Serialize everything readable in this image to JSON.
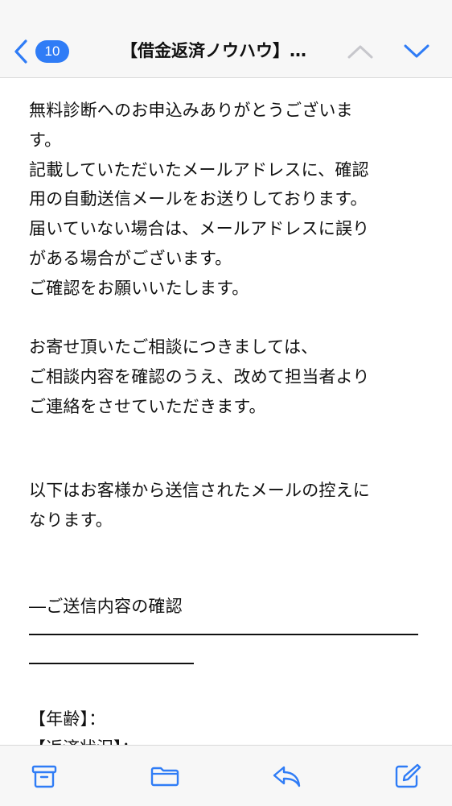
{
  "nav": {
    "badge_count": "10",
    "title": "【借金返済ノウハウ】…",
    "accent_color": "#2f7cf6",
    "icons": [
      "chevron-left-icon",
      "chevron-up-icon",
      "chevron-down-icon"
    ]
  },
  "message": {
    "paragraph1": [
      "無料診断へのお申込みありがとうございま",
      "す。",
      "記載していただいたメールアドレスに、確認",
      "用の自動送信メールをお送りしております。",
      "届いていない場合は、メールアドレスに誤り",
      "がある場合がございます。",
      "ご確認をお願いいたします。"
    ],
    "paragraph2": [
      "お寄せ頂いたご相談につきましては、",
      "ご相談内容を確認のうえ、改めて担当者より",
      "ご連絡をさせていただきます。"
    ],
    "paragraph3": [
      "以下はお客様から送信されたメールの控えに",
      "なります。"
    ],
    "confirm_heading": "―ご送信内容の確認",
    "age_label": "【年齢】：",
    "cut_line": "【返済状況】：…"
  },
  "toolbar": {
    "icons": [
      "archive-icon",
      "folder-icon",
      "reply-icon",
      "compose-icon"
    ]
  }
}
